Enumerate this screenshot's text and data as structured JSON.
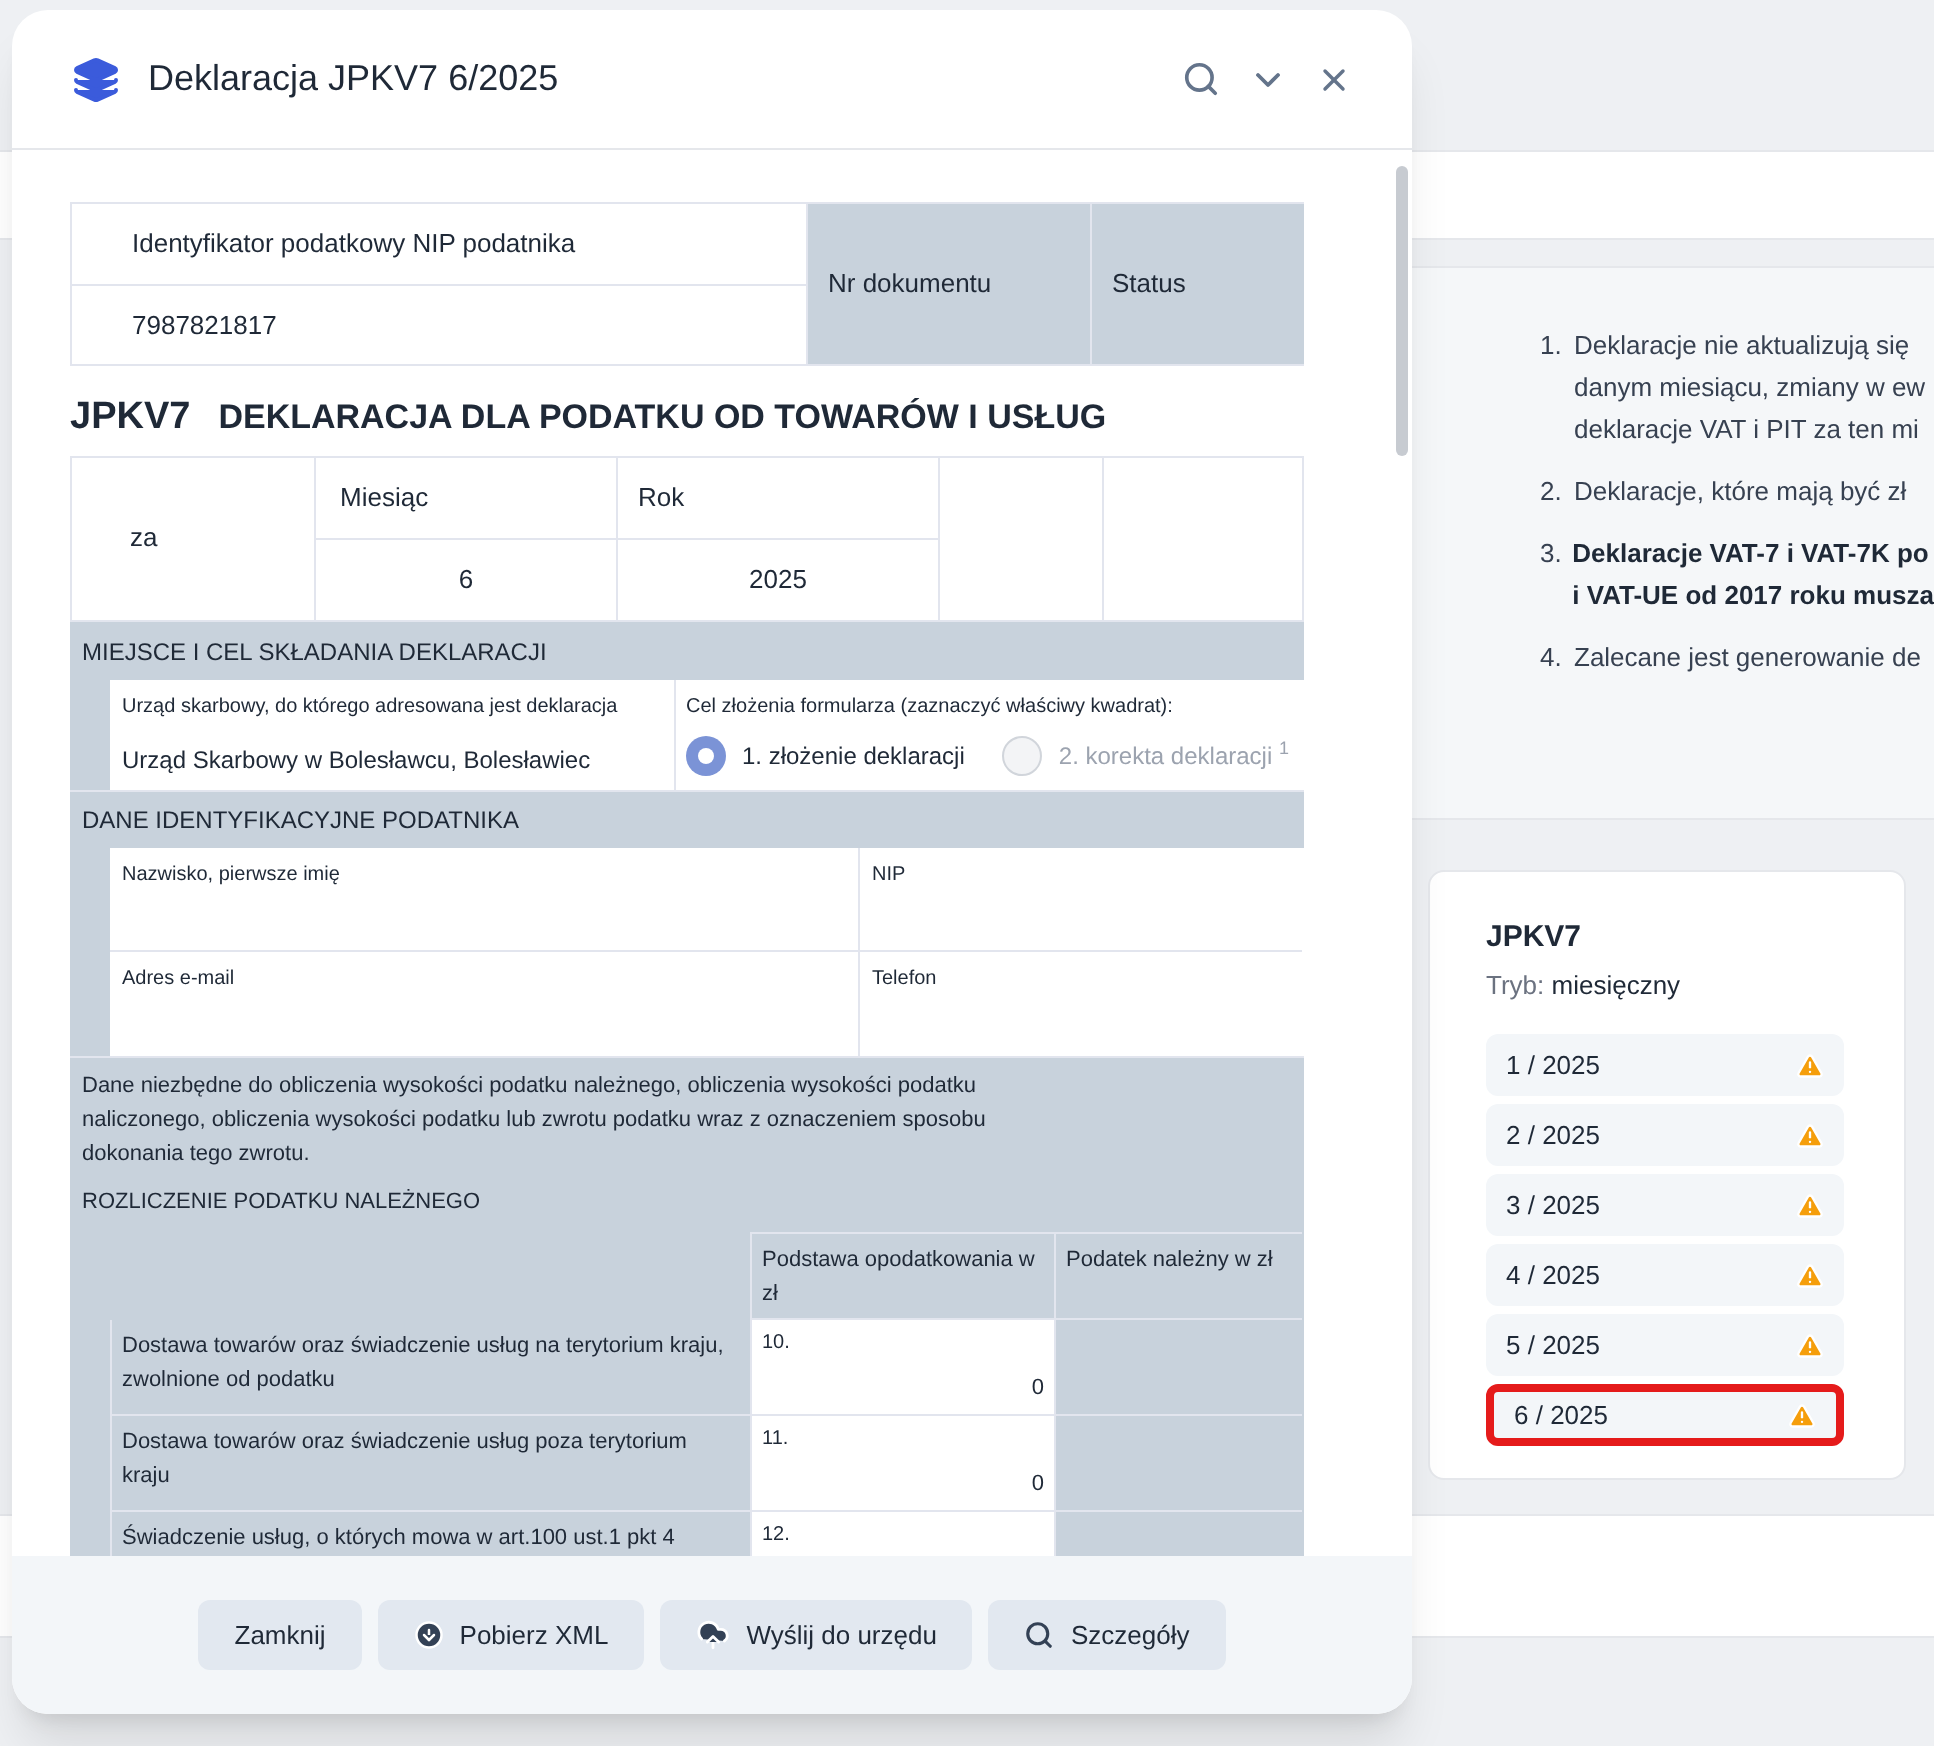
{
  "dialog": {
    "title": "Deklaracja JPKV7 6/2025"
  },
  "form": {
    "nip_label": "Identyfikator podatkowy NIP podatnika",
    "nip_value": "7987821817",
    "doc_number_label": "Nr dokumentu",
    "status_label": "Status",
    "form_code": "JPKV7",
    "form_title": "DEKLARACJA DLA PODATKU OD TOWARÓW I USŁUG",
    "period": {
      "prefix": "za",
      "month_label": "Miesiąc",
      "year_label": "Rok",
      "month": "6",
      "year": "2025"
    },
    "place_section": {
      "title": "MIEJSCE I CEL SKŁADANIA DEKLARACJI",
      "office_label": "Urząd skarbowy, do którego adresowana jest deklaracja",
      "office_value": "Urząd Skarbowy w Bolesławcu, Bolesławiec",
      "purpose_label": "Cel złożenia formularza (zaznaczyć właściwy kwadrat):",
      "options": [
        {
          "label": "1. złożenie deklaracji",
          "selected": true
        },
        {
          "label": "2. korekta deklaracji $^{1}$",
          "selected": false
        }
      ]
    },
    "identity_section": {
      "title": "DANE IDENTYFIKACYJNE PODATNIKA",
      "fields": [
        {
          "label": "Nazwisko, pierwsze imię"
        },
        {
          "label": "NIP"
        },
        {
          "label": "Adres e-mail"
        },
        {
          "label": "Telefon"
        }
      ]
    },
    "calc_section": {
      "intro": "Dane niezbędne do obliczenia wysokości podatku należnego, obliczenia wysokości podatku naliczonego, obliczenia wysokości podatku lub zwrotu podatku wraz z oznaczeniem sposobu dokonania tego zwrotu.",
      "title": "ROZLICZENIE PODATKU NALEŻNEGO",
      "columns": [
        "Podstawa opodatkowania w zł",
        "Podatek należny w zł"
      ],
      "rows": [
        {
          "label": "Dostawa towarów oraz świadczenie usług na terytorium kraju, zwolnione od podatku",
          "number": "10.",
          "value": "0"
        },
        {
          "label": "Dostawa towarów oraz świadczenie usług poza terytorium kraju",
          "number": "11.",
          "value": "0"
        },
        {
          "label": "Świadczenie usług, o których mowa w art.100 ust.1 pkt 4",
          "number": "12.",
          "value": ""
        }
      ]
    }
  },
  "footer_buttons": [
    {
      "label": "Zamknij",
      "kind": "plain"
    },
    {
      "label": "Pobierz XML",
      "kind": "download"
    },
    {
      "label": "Wyślij do urzędu",
      "kind": "upload"
    },
    {
      "label": "Szczegóły",
      "kind": "search"
    }
  ],
  "notes": [
    {
      "lines": [
        "Deklaracje nie aktualizują się",
        "danym miesiącu, zmiany w ew",
        "deklaracje VAT i PIT za ten mi"
      ],
      "bold": false
    },
    {
      "lines": [
        "Deklaracje, które mają być zł"
      ],
      "bold": false
    },
    {
      "lines": [
        "Deklaracje VAT-7 i VAT-7K po",
        "i VAT-UE od 2017 roku musza"
      ],
      "bold": true
    },
    {
      "lines": [
        "Zalecane jest generowanie de"
      ],
      "bold": false
    }
  ],
  "note_numbers": [
    "1.",
    "2.",
    "3.",
    "4."
  ],
  "declaration_card": {
    "title": "JPKV7",
    "mode_label": "Tryb:",
    "mode_value": "miesięczny",
    "periods": [
      {
        "label": "1 / 2025",
        "warning": true,
        "selected": false
      },
      {
        "label": "2 / 2025",
        "warning": true,
        "selected": false
      },
      {
        "label": "3 / 2025",
        "warning": true,
        "selected": false
      },
      {
        "label": "4 / 2025",
        "warning": true,
        "selected": false
      },
      {
        "label": "5 / 2025",
        "warning": true,
        "selected": false
      },
      {
        "label": "6 / 2025",
        "warning": true,
        "selected": true
      }
    ]
  }
}
